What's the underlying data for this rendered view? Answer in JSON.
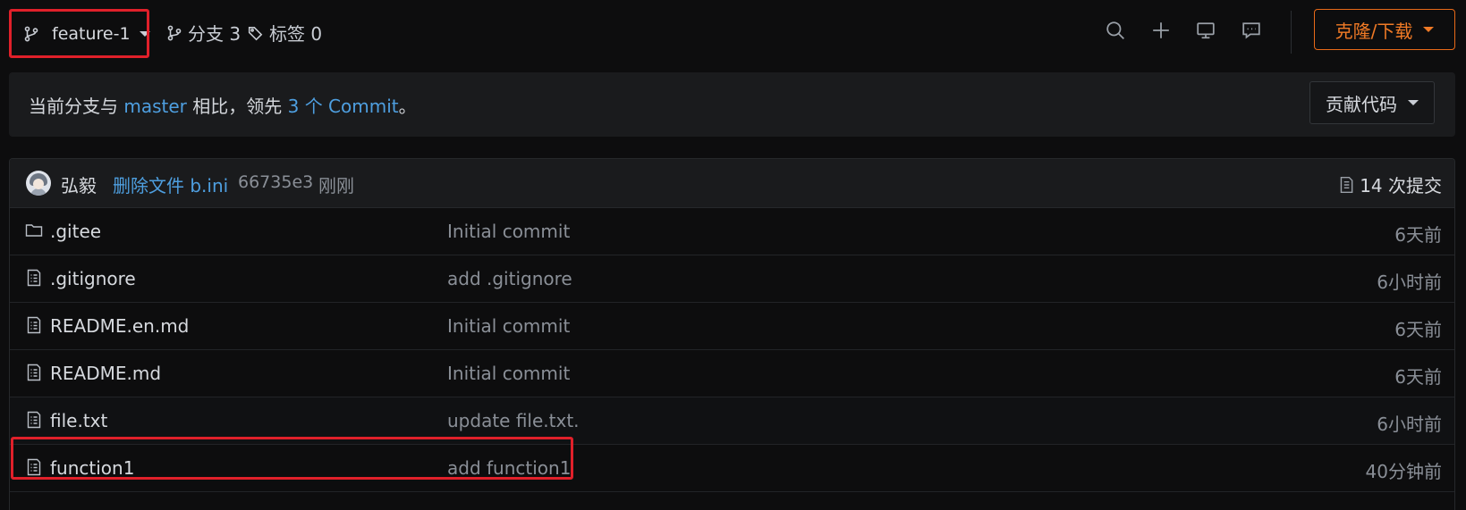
{
  "toolbar": {
    "branch_name": "feature-1",
    "branches_label": "分支 3",
    "tags_label": "标签 0",
    "clone_label": "克隆/下载"
  },
  "compare": {
    "prefix": "当前分支与 ",
    "base_branch": "master",
    "middle": " 相比，领先 ",
    "ahead": "3 个 Commit",
    "suffix": "。",
    "contribute_label": "贡献代码"
  },
  "latest_commit": {
    "author": "弘毅",
    "message": "删除文件 b.ini",
    "hash": "66735e3",
    "time": "刚刚",
    "commit_count": "14 次提交"
  },
  "files": [
    {
      "name": ".gitee",
      "type": "folder",
      "message": "Initial commit",
      "time": "6天前"
    },
    {
      "name": ".gitignore",
      "type": "file",
      "message": "add .gitignore",
      "time": "6小时前"
    },
    {
      "name": "README.en.md",
      "type": "file",
      "message": "Initial commit",
      "time": "6天前"
    },
    {
      "name": "README.md",
      "type": "file",
      "message": "Initial commit",
      "time": "6天前"
    },
    {
      "name": "file.txt",
      "type": "file",
      "message": "update file.txt.",
      "time": "6小时前"
    },
    {
      "name": "function1",
      "type": "file",
      "message": "add function1",
      "time": "40分钟前"
    }
  ],
  "colors": {
    "accent_orange": "#f07a26",
    "link_blue": "#4e9fe0",
    "highlight_red": "#e0202a"
  }
}
